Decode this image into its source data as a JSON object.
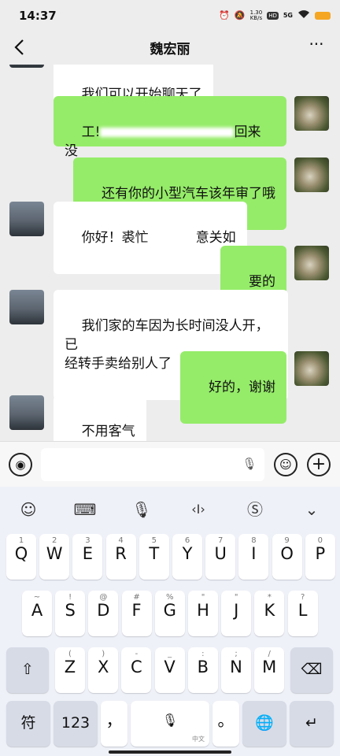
{
  "status_bar": {
    "time": "14:37",
    "net_speed_value": "1.30",
    "net_speed_unit": "KB/s",
    "hd_label": "HD",
    "signal_label": "5G",
    "icons": [
      "alarm-icon",
      "mute-icon",
      "wifi-icon",
      "battery-icon"
    ]
  },
  "header": {
    "title": "魏宏丽",
    "more_label": "···"
  },
  "messages": [
    {
      "side": "other",
      "text": "我们可以开始聊天了"
    },
    {
      "side": "self",
      "text_a": "工!",
      "text_b": "回来",
      "text_c": "没"
    },
    {
      "side": "self",
      "text": "还有你的小型汽车该年审了哦"
    },
    {
      "side": "other",
      "text_a": "你好！裘忙",
      "text_b": "意关如"
    },
    {
      "side": "self",
      "text": "要的"
    },
    {
      "side": "other",
      "text": "我们家的车因为长时间没人开，已\n经转手卖给别人了"
    },
    {
      "side": "self",
      "text": "好的，谢谢"
    },
    {
      "side": "other",
      "text": "不用客气"
    }
  ],
  "input_bar": {
    "voice_icon": "voice-icon",
    "emoji_icon": "emoji-icon",
    "plus_label": "+"
  },
  "keyboard": {
    "toolbar": [
      "smiley-icon",
      "keyboard-icon",
      "mic-icon",
      "cursor-icon",
      "sogou-icon",
      "chevron-down-icon"
    ],
    "row1": [
      [
        "Q",
        "1"
      ],
      [
        "W",
        "2"
      ],
      [
        "E",
        "3"
      ],
      [
        "R",
        "4"
      ],
      [
        "T",
        "5"
      ],
      [
        "Y",
        "6"
      ],
      [
        "U",
        "7"
      ],
      [
        "I",
        "8"
      ],
      [
        "O",
        "9"
      ],
      [
        "P",
        "0"
      ]
    ],
    "row2": [
      [
        "A",
        "~"
      ],
      [
        "S",
        "!"
      ],
      [
        "D",
        "@"
      ],
      [
        "F",
        "#"
      ],
      [
        "G",
        "%"
      ],
      [
        "H",
        "\""
      ],
      [
        "J",
        "\""
      ],
      [
        "K",
        "*"
      ],
      [
        "L",
        "?"
      ]
    ],
    "row3": [
      [
        "Z",
        "("
      ],
      [
        "X",
        ")"
      ],
      [
        "C",
        "-"
      ],
      [
        "V",
        "_"
      ],
      [
        "B",
        ":"
      ],
      [
        "N",
        ";"
      ],
      [
        "M",
        "/"
      ]
    ],
    "fu_label": "符",
    "num_label": "123",
    "comma_label": "，",
    "space_label": "中文",
    "period_label": "。",
    "colors": {
      "bubble_self": "#95ec69",
      "bubble_other": "#ffffff",
      "chat_bg": "#ededed",
      "keyboard_bg": "#eff1f8"
    }
  }
}
